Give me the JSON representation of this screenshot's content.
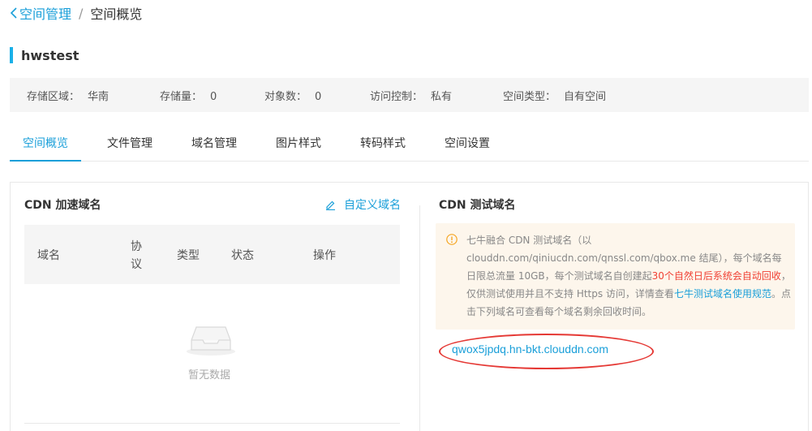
{
  "breadcrumb": {
    "parent": "空间管理",
    "separator": "/",
    "current": "空间概览"
  },
  "bucket": {
    "name": "hwstest"
  },
  "info": [
    {
      "label": "存储区域：",
      "value": "华南"
    },
    {
      "label": "存储量：",
      "value": "0"
    },
    {
      "label": "对象数：",
      "value": "0"
    },
    {
      "label": "访问控制：",
      "value": "私有"
    },
    {
      "label": "空间类型：",
      "value": "自有空间"
    }
  ],
  "tabs": [
    "空间概览",
    "文件管理",
    "域名管理",
    "图片样式",
    "转码样式",
    "空间设置"
  ],
  "active_tab": "空间概览",
  "cdn": {
    "title": "CDN 加速域名",
    "custom_link": "自定义域名",
    "columns": [
      "域名",
      "协议",
      "类型",
      "状态",
      "操作"
    ],
    "empty_text": "暂无数据"
  },
  "test": {
    "title": "CDN 测试域名",
    "notice": {
      "part1": "七牛融合 CDN 测试域名（以 clouddn.com/qiniucdn.com/qnssl.com/qbox.me 结尾），每个域名每日限总流量 10GB，每个测试域名自创建起",
      "highlight_red": "30个自然日后系统会自动回收",
      "part2": "，仅供测试使用并且不支持 Https 访问，详情查看",
      "highlight_link": "七牛测试域名使用规范",
      "part3": "。点击下列域名可查看每个域名剩余回收时间。"
    },
    "domain": "qwox5jpdq.hn-bkt.clouddn.com"
  },
  "colors": {
    "accent": "#1a9fd9",
    "warning_bg": "#fdf6ec",
    "warning_icon": "#f5a623",
    "alert_red": "#f04134",
    "annotation": "#e53935"
  }
}
